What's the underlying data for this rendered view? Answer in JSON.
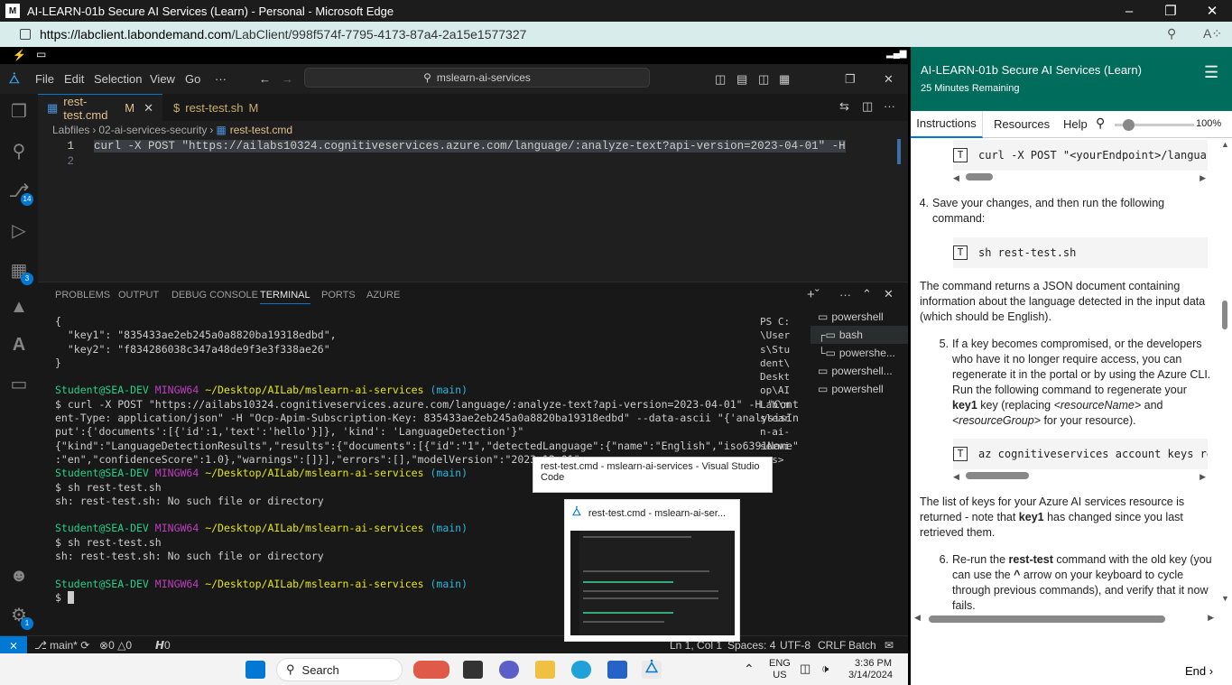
{
  "browser": {
    "title": "AI-LEARN-01b Secure AI Services (Learn) - Personal - Microsoft Edge",
    "url_host": "https://labclient.labondemand.com",
    "url_path": "/LabClient/998f574f-7795-4173-87a4-2a15e1577327"
  },
  "vscode": {
    "menu": [
      "File",
      "Edit",
      "Selection",
      "View",
      "Go"
    ],
    "search": "mslearn-ai-services",
    "tabs": [
      {
        "label": "rest-test.cmd",
        "status": "M"
      },
      {
        "label": "rest-test.sh",
        "status": "M"
      }
    ],
    "breadcrumb": [
      "Labfiles",
      "02-ai-services-security",
      "rest-test.cmd"
    ],
    "editor_lines": [
      {
        "num": "1",
        "text": "curl -X POST \"https://ailabs10324.cognitiveservices.azure.com/language/:analyze-text?api-version=2023-04-01\" -H"
      },
      {
        "num": "2",
        "text": ""
      }
    ],
    "activity_badges": {
      "source_control": "14",
      "extensions": "3",
      "settings": "1"
    },
    "panel_tabs": [
      "PROBLEMS",
      "OUTPUT",
      "DEBUG CONSOLE",
      "TERMINAL",
      "PORTS",
      "AZURE"
    ],
    "terminal": {
      "json_lines": [
        "{",
        "  \"key1\": \"835433ae2eb245a0a8820ba19318edbd\",",
        "  \"key2\": \"f834286038c347a48de9f3e3f338ae26\"",
        "}"
      ],
      "prompt_user": "Student@SEA-DEV",
      "prompt_host": "MINGW64",
      "prompt_path": "~/Desktop/AILab/mslearn-ai-services",
      "prompt_branch": "(main)",
      "cmd1": [
        "$ curl -X POST \"https://ailabs10324.cognitiveservices.azure.com/language/:analyze-text?api-version=2023-04-01\" -H \"Cont",
        "ent-Type: application/json\" -H \"Ocp-Apim-Subscription-Key: 835433ae2eb245a0a8820ba19318edbd\" --data-ascii \"{'analysisIn",
        "put':{'documents':[{'id':1,'text':'hello'}]}, 'kind': 'LanguageDetection'}\"",
        "{\"kind\":\"LanguageDetectionResults\",\"results\":{\"documents\":[{\"id\":\"1\",\"detectedLanguage\":{\"name\":\"English\",\"iso6391Name\"",
        ":\"en\",\"confidenceScore\":1.0},\"warnings\":[]}],\"errors\":[],\"modelVersion\":\"2023-12-01\""
      ],
      "cmd2": "$ sh rest-test.sh",
      "err2": "sh: rest-test.sh: No such file or directory",
      "cmd3": "$ sh rest-test.sh",
      "err3": "sh: rest-test.sh: No such file or directory",
      "last": "$ ",
      "side_lines": [
        "PS C:",
        "\\User",
        "s\\Stu",
        "dent\\",
        "Deskt",
        "op\\AI",
        "Lab\\m",
        "slear",
        "n-ai-",
        "servi",
        "ces>"
      ],
      "list": [
        "powershell",
        "bash",
        "powershe...",
        "powershell...",
        "powershell"
      ]
    },
    "status": {
      "branch": "main*",
      "errors": "0",
      "warnings": "0",
      "ports": "0",
      "position": "Ln 1, Col 1",
      "spaces": "Spaces: 4",
      "encoding": "UTF-8",
      "eol": "CRLF",
      "language": "Batch"
    },
    "tooltip": "rest-test.cmd - mslearn-ai-services - Visual Studio Code",
    "thumb_title": "rest-test.cmd - mslearn-ai-ser..."
  },
  "lab": {
    "title": "AI-LEARN-01b Secure AI Services (Learn)",
    "remaining": "25 Minutes Remaining",
    "tabs": [
      "Instructions",
      "Resources",
      "Help"
    ],
    "zoom": "100%",
    "code1": "curl -X POST \"<yourEndpoint>/langua",
    "step4_num": "4.",
    "step4": "Save your changes, and then run the following command:",
    "code2": "sh rest-test.sh",
    "para1": "The command returns a JSON document containing information about the language detected in the input data (which should be English).",
    "step5_num": "5.",
    "step5_a": "If a key becomes compromised, or the developers who have it no longer require access, you can regenerate it in the portal or by using the Azure CLI. Run the following command to regenerate your ",
    "step5_key": "key1",
    "step5_b": " key (replacing ",
    "step5_rn": "<resourceName>",
    "step5_and": " and ",
    "step5_rg": "<resourceGroup>",
    "step5_c": " for your resource).",
    "code3": "az cognitiveservices account keys reg",
    "para2_a": "The list of keys for your Azure AI services resource is returned - note that ",
    "para2_key": "key1",
    "para2_b": " has changed since you last retrieved them.",
    "step6_num": "6.",
    "step6_a": "Re-run the ",
    "step6_cmd": "rest-test",
    "step6_b": " command with the old key (you can use the ",
    "step6_caret": "^",
    "step6_c": " arrow on your keyboard to cycle through previous commands), and verify that it now fails.",
    "end_label": "End"
  },
  "taskbar": {
    "search": "Search",
    "lang1": "ENG",
    "lang2": "US",
    "time": "3:36 PM",
    "date": "3/14/2024"
  }
}
